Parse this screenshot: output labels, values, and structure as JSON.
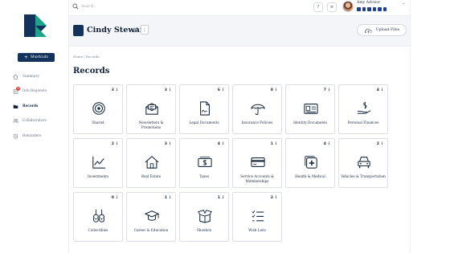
{
  "topbar": {
    "search_placeholder": "Search...",
    "help_icon": "?",
    "menu_icon": "≡",
    "user_name": "Amy Advisor"
  },
  "sidebar": {
    "shortcuts_label": "Shortcuts",
    "items": [
      {
        "label": "Summary",
        "icon": "home-icon"
      },
      {
        "label": "Info Requests",
        "icon": "info-requests-icon",
        "badge": "4"
      },
      {
        "label": "Records",
        "icon": "folder-icon",
        "active": true
      },
      {
        "label": "Collaborators",
        "icon": "collaborators-icon"
      },
      {
        "label": "Reminders",
        "icon": "alarm-icon"
      }
    ]
  },
  "header": {
    "profile_name": "Cindy Stewart",
    "kebab": "⋮",
    "upload_label": "Upload Files"
  },
  "main": {
    "breadcrumb": "Home / Records",
    "title": "Records"
  },
  "records": [
    {
      "label": "Shared",
      "count": "3",
      "icon": "shared-icon"
    },
    {
      "label": "Newsletters & Promotions",
      "count": "3",
      "icon": "newsletter-icon"
    },
    {
      "label": "Legal Documents",
      "count": "6",
      "icon": "legal-document-icon"
    },
    {
      "label": "Insurance Policies",
      "count": "8",
      "icon": "umbrella-icon"
    },
    {
      "label": "Identity Documents",
      "count": "7",
      "icon": "id-card-icon"
    },
    {
      "label": "Personal Finances",
      "count": "4",
      "icon": "finance-hand-icon"
    },
    {
      "label": "Investments",
      "count": "2",
      "icon": "investment-chart-icon"
    },
    {
      "label": "Real Estate",
      "count": "3",
      "icon": "house-icon"
    },
    {
      "label": "Taxes",
      "count": "4",
      "icon": "taxes-icon"
    },
    {
      "label": "Service Accounts & Memberships",
      "count": "1",
      "icon": "credit-card-icon"
    },
    {
      "label": "Health & Medical",
      "count": "4",
      "icon": "medical-icon"
    },
    {
      "label": "Vehicles & Transportation",
      "count": "2",
      "icon": "car-icon"
    },
    {
      "label": "Collectibles",
      "count": "0",
      "icon": "guitar-icon"
    },
    {
      "label": "Career & Education",
      "count": "1",
      "icon": "graduation-cap-icon"
    },
    {
      "label": "Shoebox",
      "count": "1",
      "icon": "box-icon"
    },
    {
      "label": "Wish Lists",
      "count": "2",
      "icon": "list-icon"
    }
  ],
  "colors": {
    "brand_navy": "#13335c",
    "brand_teal": "#1fa38a",
    "badge_red": "#e53935"
  }
}
